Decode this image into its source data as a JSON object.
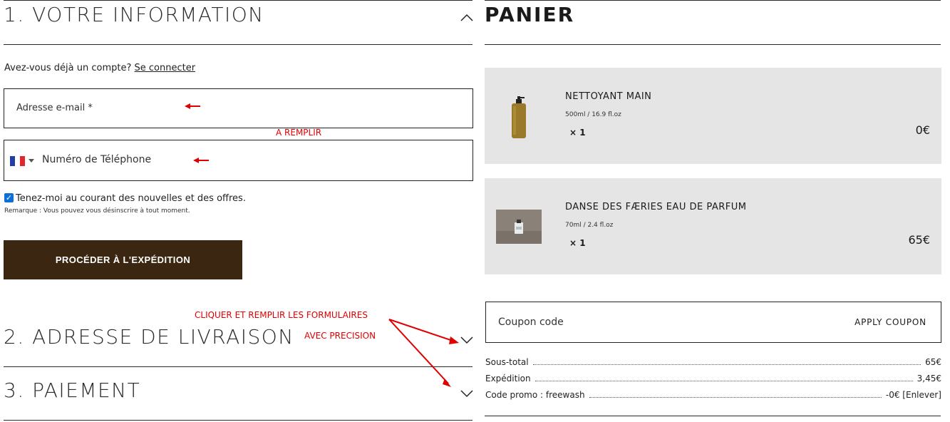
{
  "checkout": {
    "section1_title": "1. VOTRE INFORMATION",
    "account_question": "Avez-vous déjà un compte?",
    "login_link": "Se connecter",
    "email_placeholder": "Adresse e-mail *",
    "phone_placeholder": "Numéro de Téléphone",
    "phone_country": "France",
    "newsletter_label": "Tenez-moi au courant des nouvelles et des offres.",
    "newsletter_checked": true,
    "remark": "Remarque : Vous pouvez vous désinscrire à tout moment.",
    "proceed_label": "PROCÉDER À L'EXPÉDITION",
    "section2_title": "2. ADRESSE DE LIVRAISON",
    "section3_title": "3. PAIEMENT"
  },
  "annotations": {
    "fill_hint": "A REMPLIR",
    "click_hint_line1": "CLIQUER ET REMPLIR LES FORMULAIRES",
    "click_hint_line2": "AVEC PRECISION",
    "color": "#e00000"
  },
  "cart": {
    "title": "PANIER",
    "items": [
      {
        "name": "NETTOYANT MAIN",
        "size": "500ml / 16.9 fl.oz",
        "qty": "× 1",
        "price": "0€",
        "image": "amber-soap-bottle-icon"
      },
      {
        "name": "DANSE DES FÆRIES EAU DE PARFUM",
        "size": "70ml / 2.4 fl.oz",
        "qty": "× 1",
        "price": "65€",
        "image": "perfume-bottle-photo"
      }
    ],
    "coupon_placeholder": "Coupon code",
    "coupon_button": "APPLY COUPON",
    "summary": [
      {
        "label": "Sous-total",
        "value": "65€"
      },
      {
        "label": "Expédition",
        "value": "3,45€"
      },
      {
        "label": "Code promo : freewash",
        "value": "-0€ [Enlever]"
      }
    ]
  },
  "colors": {
    "brand_button": "#3a2611",
    "cart_bg": "#e5e5e5",
    "checkbox": "#0b6fd8"
  }
}
